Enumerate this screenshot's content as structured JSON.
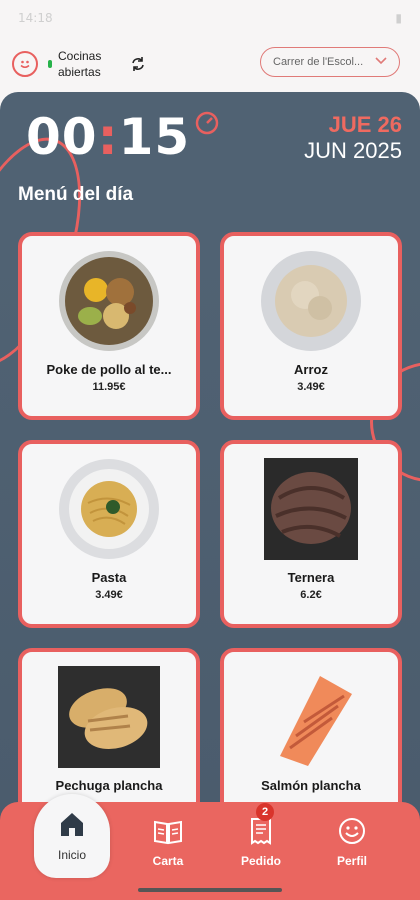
{
  "status_bar": {
    "time": "14:18",
    "battery": "▮"
  },
  "header": {
    "kitchen_status": "Cocinas abiertas",
    "location": "Carrer de l'Escol..."
  },
  "timer": {
    "minutes": "00",
    "separator": ":",
    "seconds": "15"
  },
  "date": {
    "day": "JUE 26",
    "month_year": "JUN 2025"
  },
  "menu": {
    "title": "Menú del día",
    "items": [
      {
        "name": "Poke de pollo al te...",
        "price": "11.95€",
        "icon": "poke-bowl-image"
      },
      {
        "name": "Arroz",
        "price": "3.49€",
        "icon": "rice-image"
      },
      {
        "name": "Pasta",
        "price": "3.49€",
        "icon": "pasta-image"
      },
      {
        "name": "Ternera",
        "price": "6.2€",
        "icon": "beef-image"
      },
      {
        "name": "Pechuga plancha",
        "price": "",
        "icon": "chicken-breast-image"
      },
      {
        "name": "Salmón plancha",
        "price": "",
        "icon": "salmon-image"
      }
    ]
  },
  "nav": {
    "home": "Inicio",
    "carta": "Carta",
    "pedido": "Pedido",
    "pedido_badge": "2",
    "perfil": "Perfil"
  },
  "colors": {
    "accent": "#e8605f",
    "panel": "#506273",
    "nav": "#ea6660"
  }
}
